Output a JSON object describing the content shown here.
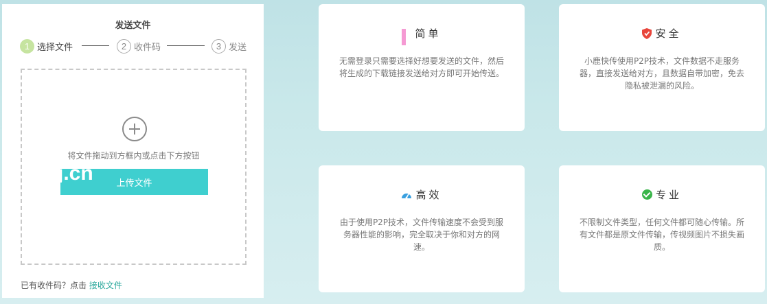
{
  "send_panel": {
    "title": "发送文件",
    "steps": [
      {
        "number": "1",
        "label": "选择文件"
      },
      {
        "number": "2",
        "label": "收件码"
      },
      {
        "number": "3",
        "label": "发送"
      }
    ],
    "drop_hint": "将文件拖动到方框内或点击下方按钮",
    "upload_label": "上传文件",
    "watermark": "j.cn",
    "receive_prompt": "已有收件码？点击",
    "receive_link": "接收文件"
  },
  "features": [
    {
      "title": "简单",
      "icon": "grid-icon",
      "body": "无需登录只需要选择好想要发送的文件，然后将生成的下载链接发送给对方即可开始传送。"
    },
    {
      "title": "安全",
      "icon": "shield-icon",
      "body": "小鹿快传使用P2P技术，文件数据不走服务器，直接发送给对方，且数据自带加密，免去隐私被泄漏的风险。"
    },
    {
      "title": "高效",
      "icon": "gauge-icon",
      "body": "由于使用P2P技术，文件传输速度不会受到服务器性能的影响，完全取决于你和对方的网速。"
    },
    {
      "title": "专业",
      "icon": "check-icon",
      "body": "不限制文件类型，任何文件都可随心传输。所有文件都是原文件传输，传视频图片不损失画质。"
    }
  ],
  "colors": {
    "accent": "#3fcfcf",
    "step_active": "#c6e4a0",
    "link": "#26a69a",
    "shield": "#e8463c",
    "check": "#3ab54a",
    "grid": "#f59ad3",
    "gauge": "#3aa0e0"
  }
}
